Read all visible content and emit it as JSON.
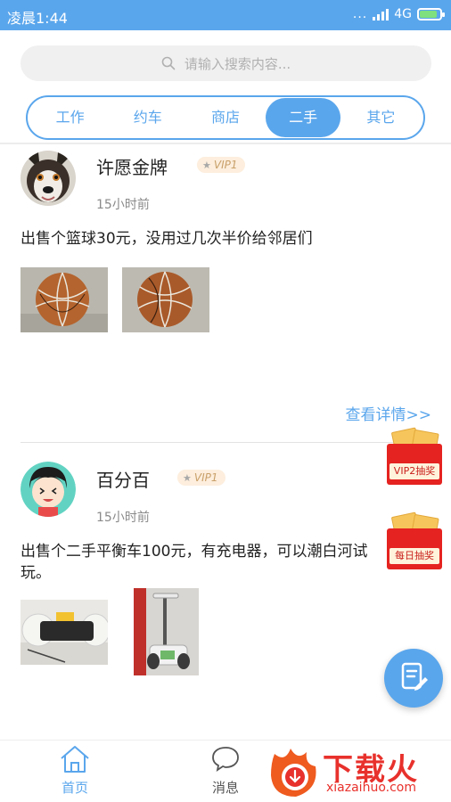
{
  "status_bar": {
    "time": "凌晨1:44",
    "network": "4G",
    "dots": "..."
  },
  "search": {
    "placeholder": "请输入搜索内容..."
  },
  "tabs": [
    {
      "label": "工作",
      "active": false
    },
    {
      "label": "约车",
      "active": false
    },
    {
      "label": "商店",
      "active": false
    },
    {
      "label": "二手",
      "active": true
    },
    {
      "label": "其它",
      "active": false
    }
  ],
  "posts": [
    {
      "username": "许愿金牌",
      "vip": "VIP1",
      "time": "15小时前",
      "text": "出售个篮球30元，没用过几次半价给邻居们",
      "details_link": "查看详情>>"
    },
    {
      "username": "百分百",
      "vip": "VIP1",
      "time": "15小时前",
      "text": "出售个二手平衡车100元，有充电器，可以潮白河试玩。"
    }
  ],
  "promos": [
    {
      "label": "VIP2抽奖"
    },
    {
      "label": "每日抽奖"
    }
  ],
  "bottom_nav": [
    {
      "label": "首页",
      "active": true
    },
    {
      "label": "消息",
      "active": false
    }
  ],
  "watermark": {
    "text": "下载火",
    "domain": "xiazaihuo.com"
  },
  "colors": {
    "accent": "#5aa6ec",
    "promo_red": "#e52320",
    "watermark_red": "#e8312c"
  }
}
